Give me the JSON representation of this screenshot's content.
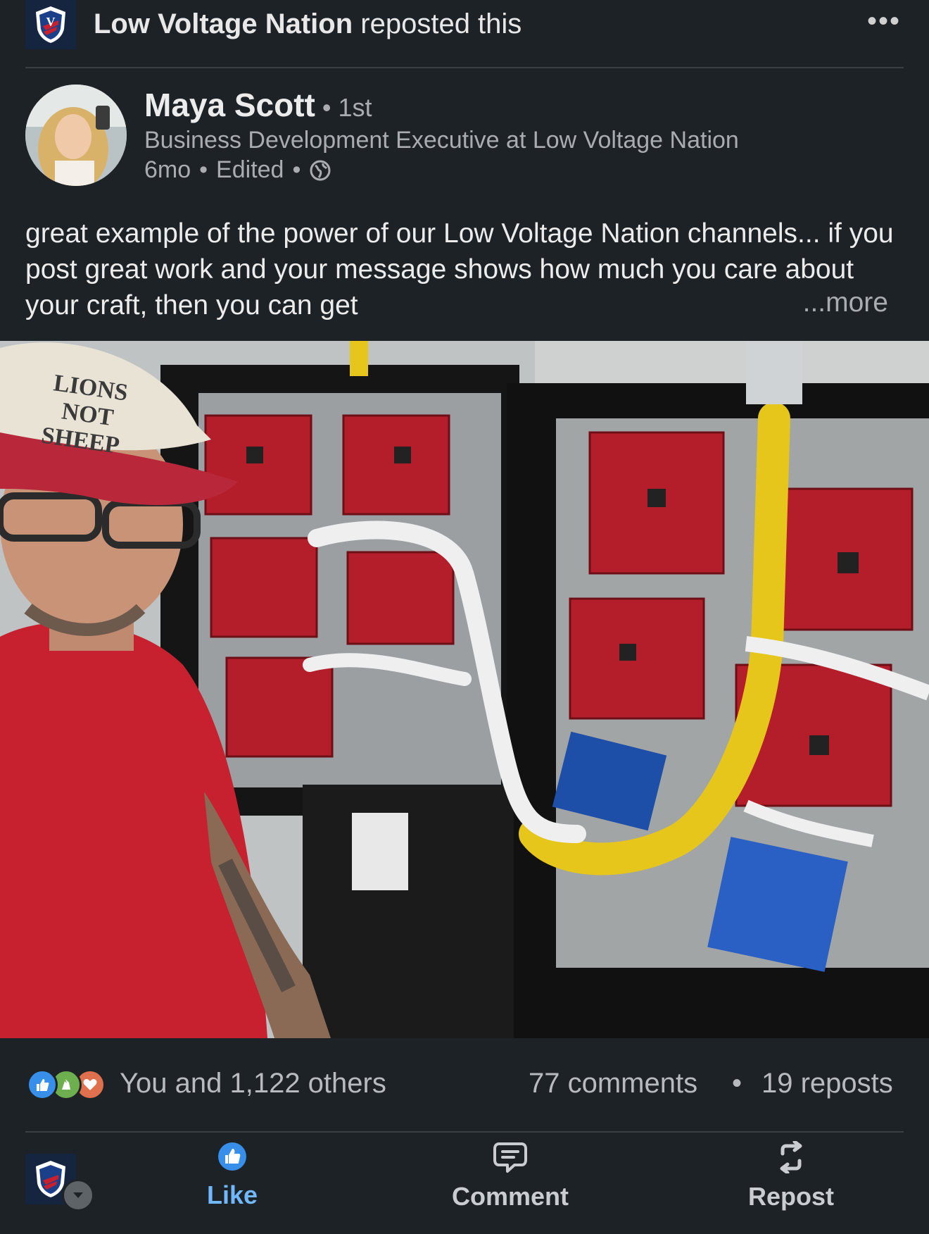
{
  "repost_header": {
    "org_name": "Low Voltage Nation",
    "action_text": " reposted this",
    "more_icon": "more-horizontal-icon"
  },
  "author": {
    "name": "Maya Scott",
    "degree": " • 1st",
    "headline": "Business Development Executive at Low Voltage Nation",
    "time": "6mo",
    "edited": "Edited",
    "sep": "•",
    "visibility_icon": "globe-icon"
  },
  "post": {
    "text": "great example of the power of our Low Voltage Nation channels...  if you post great work and your message shows how much you care about your craft, then you can get",
    "see_more": "...more",
    "photo_hat_text": "LIONS NOT SHEEP"
  },
  "social": {
    "reaction_icons": [
      "like-reaction-icon",
      "celebrate-reaction-icon",
      "love-reaction-icon"
    ],
    "likes": "You and 1,122 others",
    "comments": "77 comments",
    "separator": "•",
    "reposts": "19 reposts"
  },
  "actions": {
    "like": "Like",
    "comment": "Comment",
    "repost": "Repost"
  },
  "colors": {
    "background": "#1d2226",
    "like_active": "#71b7fb",
    "text_secondary": "#a9adb1"
  }
}
